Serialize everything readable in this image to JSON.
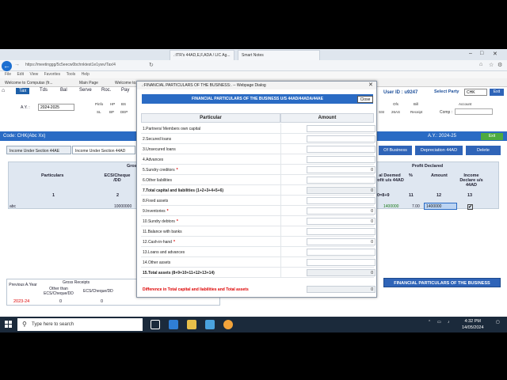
{
  "browser": {
    "url": "https://meetinggg/5c5eecw0bchnktest1e1ywv/Tax/4",
    "tabs": [
      ".:ITR's 44AD,E,F,ADA / LIC Ag...",
      "Smart Notes"
    ],
    "menu": [
      "File",
      "Edit",
      "View",
      "Favorites",
      "Tools",
      "Help"
    ],
    "favorites": [
      "Welcome to Computax (fr...",
      "Main Page",
      "Welcome to..."
    ]
  },
  "app": {
    "tabs": [
      "Tax",
      "Tds",
      "Bal",
      "Serve",
      "Roc.",
      "Pay"
    ],
    "ay_label": "A.Y. :",
    "ay_value": "2024-2025",
    "mini_labels": {
      "pinfo": "Pinfo",
      "hp": "HP",
      "bs": "BS",
      "sl": "SL",
      "bp": "BP",
      "dep": "DEP",
      "ofs": "Ofs",
      "ssi": "SSI",
      "twentysix": "26AS",
      "bill": "Bill",
      "receipt": "Receipt",
      "account": "Account"
    },
    "user_id": "User ID : u9247",
    "select_party_label": "Select Party",
    "party_value": "CHK",
    "exit_label": "Exit",
    "comp_label": "Comp :",
    "code_label": "Code: CHK(Abc Xx)",
    "ay_right": "A.Y.: 2024-25",
    "exit2_label": "Exit",
    "subtabs": [
      "Income Under Section 44AE",
      "Income Under Section 44AD"
    ],
    "right_buttons": [
      "Of Business",
      "Depreciation 44AD",
      "Delete"
    ],
    "grid": {
      "particulars": "Particulars",
      "ecs_cheque": "ECS/Cheque /DD",
      "gross": "Gros",
      "col1": "1",
      "col2": "2",
      "profit_declared": "Profit Declared",
      "deemed": "al Deemed rofit u/s 44AD",
      "pct": "%",
      "amount": "Amount",
      "income_declare": "Income Declare u/s 44AD",
      "formula": "0=8+9",
      "c11": "11",
      "c12": "12",
      "c13": "13",
      "row_name": "abc",
      "row_ecs": "10000000",
      "row_deemed": "1400000",
      "row_pct": "7.00",
      "row_amount": "1400000",
      "row_check": "✔"
    },
    "bottom": {
      "previous_ay": "Previous A.Year",
      "gross_receipts": "Gross Receipts",
      "other_than": "Other than ECS/Cheque/DD",
      "ecs": "ECS/Cheque/DD",
      "year": "2023-24",
      "v1": "0",
      "v2": "0"
    },
    "fin_button": "FINANCIAL PARTICULARS OF THE BUSINESS"
  },
  "dialog": {
    "title": ".:FINANCIAL PARTICULARS OF THE BUSINESS:. -- Webpage Dialog",
    "heading": "FINANCIAL PARTICULARS OF THE BUSINESS U/S 44AD/44ADA/44AE",
    "close_label": "Close",
    "col_particular": "Particular",
    "col_amount": "Amount",
    "rows": [
      {
        "label": "1.Partners/ Members own capital",
        "amount": ""
      },
      {
        "label": "2.Secured loans",
        "amount": ""
      },
      {
        "label": "3.Unsecured loans",
        "amount": ""
      },
      {
        "label": "4.Advances",
        "amount": ""
      },
      {
        "label": "5.Sundry creditors",
        "star": "*",
        "amount": "0"
      },
      {
        "label": "6.Other liabilities",
        "amount": ""
      },
      {
        "label": "7.Total capital and liabilities (1+2+3+4+5+6)",
        "amount": "0"
      },
      {
        "label": "8.Fixed assets",
        "amount": ""
      },
      {
        "label": "9.Inventories",
        "star": "*",
        "amount": "0"
      },
      {
        "label": "10.Sundry debtors",
        "star": "*",
        "amount": "0"
      },
      {
        "label": "11.Balance with banks",
        "amount": ""
      },
      {
        "label": "12.Cash-in-hand",
        "star": "*",
        "amount": "0"
      },
      {
        "label": "13.Loans and advances",
        "amount": ""
      },
      {
        "label": "14.Other assets",
        "amount": ""
      },
      {
        "label": "15.Total assets (8+9+10+11+12+13+14)",
        "amount": "0"
      }
    ],
    "difference_label": "Difference in Total capital and liabilities and Total assets",
    "difference_amount": "0"
  },
  "taskbar": {
    "search_placeholder": "Type here to search",
    "time": "4:32 PM",
    "date": "14/05/2024"
  }
}
